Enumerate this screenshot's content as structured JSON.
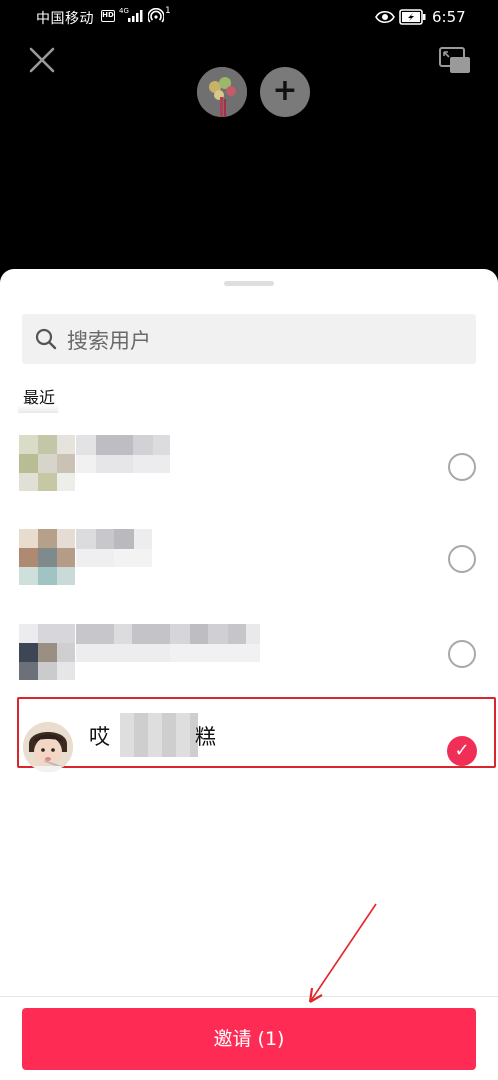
{
  "status_bar": {
    "carrier": "中国移动",
    "hd": "HD",
    "network": "4G",
    "hotspot_sup": "1",
    "time": "6:57"
  },
  "top_controls": {
    "close_icon": "close-icon",
    "pip_icon": "picture-in-picture-icon",
    "add_label": "+"
  },
  "search": {
    "placeholder": "搜索用户",
    "icon": "search-icon"
  },
  "recent": {
    "label": "最近"
  },
  "contacts": [
    {
      "name": "",
      "selected": false
    },
    {
      "name": "",
      "selected": false
    },
    {
      "name": "",
      "selected": false
    },
    {
      "name_prefix": "哎",
      "name_suffix": "糕",
      "selected": true
    }
  ],
  "invite_button": {
    "label": "邀请 (1)"
  },
  "colors": {
    "accent": "#fe2c55",
    "check": "#f02f57",
    "highlight_box": "#d9262c"
  }
}
